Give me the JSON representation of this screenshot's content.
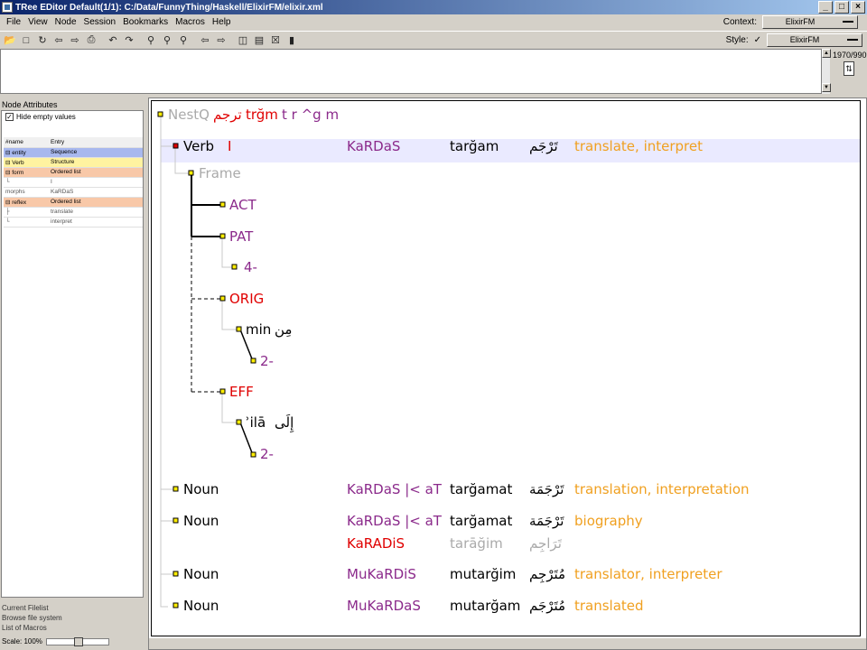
{
  "window": {
    "title": "TRee EDitor   Default(1/1): C:/Data/FunnyThing/Haskell/ElixirFM/elixir.xml",
    "buttons": [
      "_",
      "□",
      "×"
    ]
  },
  "menu": [
    "File",
    "View",
    "Node",
    "Session",
    "Bookmarks",
    "Macros",
    "Help"
  ],
  "context": {
    "label": "Context:",
    "value": "ElixirFM"
  },
  "style": {
    "label": "Style:",
    "value": "ElixirFM"
  },
  "counter": "1970/9909",
  "left_panel": {
    "title": "Node Attributes",
    "hide_empty": "Hide empty values",
    "rows": [
      {
        "name": "#name",
        "entry": "Entry",
        "kind": "hdr"
      },
      {
        "name": "⊟ entity",
        "entry": "Sequence",
        "kind": "blue"
      },
      {
        "name": "  ⊟ Verb",
        "entry": "Structure",
        "kind": "yellow"
      },
      {
        "name": "    ⊟ form",
        "entry": "Ordered list",
        "kind": "salmon"
      },
      {
        "name": "      └",
        "entry": "I",
        "kind": "grey"
      },
      {
        "name": "morphs",
        "entry": "KaRDaS",
        "kind": "grey"
      },
      {
        "name": "⊟ reflex",
        "entry": "Ordered list",
        "kind": "salmon"
      },
      {
        "name": "  ├",
        "entry": "translate",
        "kind": "grey"
      },
      {
        "name": "  └",
        "entry": "interpret",
        "kind": "grey"
      }
    ],
    "links": [
      "Current Filelist",
      "Browse file system",
      "List of Macros"
    ],
    "scale": "Scale: 100%"
  },
  "tree": {
    "root": {
      "label": "NestQ",
      "arabic": "ترجم",
      "trans": "trğm",
      "roots": "t r ^g m"
    },
    "verb": {
      "label": "Verb",
      "form": "I",
      "pattern": "KaRDaS",
      "translit": "tarğam",
      "arabic": "تَرْجَم",
      "gloss": "translate, interpret"
    },
    "frame": "Frame",
    "act": "ACT",
    "pat": "PAT",
    "pat_idx": "4-",
    "orig": "ORIG",
    "min_latin": "min",
    "min_arabic": "مِن",
    "orig_idx": "2-",
    "eff": "EFF",
    "ila_latin": "ʾilā",
    "ila_arabic": "إِلَى",
    "eff_idx": "2-",
    "nouns": [
      {
        "label": "Noun",
        "pattern": "KaRDaS |< aT",
        "translit": "tarğamat",
        "arabic": "تَرْجَمَة",
        "gloss": "translation, interpretation"
      },
      {
        "label": "Noun",
        "pattern": "KaRDaS |< aT",
        "translit": "tarğamat",
        "arabic": "تَرْجَمَة",
        "gloss": "biography",
        "plural_pattern": "KaRADiS",
        "plural_translit": "tarāğim",
        "plural_arabic": "تَرَاجِم"
      },
      {
        "label": "Noun",
        "pattern": "MuKaRDiS",
        "translit": "mutarğim",
        "arabic": "مُتَرْجِم",
        "gloss": "translator, interpreter"
      },
      {
        "label": "Noun",
        "pattern": "MuKaRDaS",
        "translit": "mutarğam",
        "arabic": "مُتَرْجَم",
        "gloss": "translated"
      }
    ]
  }
}
